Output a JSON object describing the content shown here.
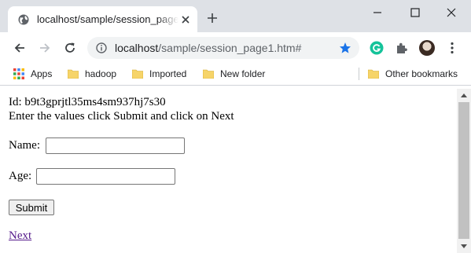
{
  "tab": {
    "title": "localhost/sample/session_page1.htm#"
  },
  "omnibox": {
    "host": "localhost",
    "path": "/sample/session_page1.htm#"
  },
  "bookmarks": {
    "items": [
      {
        "label": "Apps",
        "icon": "apps-grid-icon"
      },
      {
        "label": "hadoop",
        "icon": "folder-icon"
      },
      {
        "label": "Imported",
        "icon": "folder-icon"
      },
      {
        "label": "New folder",
        "icon": "folder-icon"
      }
    ],
    "other": "Other bookmarks"
  },
  "page": {
    "id_line": "Id: b9t3gprjtl35ms4sm937hj7s30",
    "instructions": "Enter the values click Submit and click on Next",
    "name_label": "Name:",
    "name_value": "",
    "age_label": "Age:",
    "age_value": "",
    "submit_label": "Submit",
    "next_link": "Next"
  },
  "colors": {
    "tabstrip": "#dee1e6",
    "accent_star": "#1a73e8",
    "grammarly": "#15c39a",
    "visited_link": "#551a8b"
  }
}
